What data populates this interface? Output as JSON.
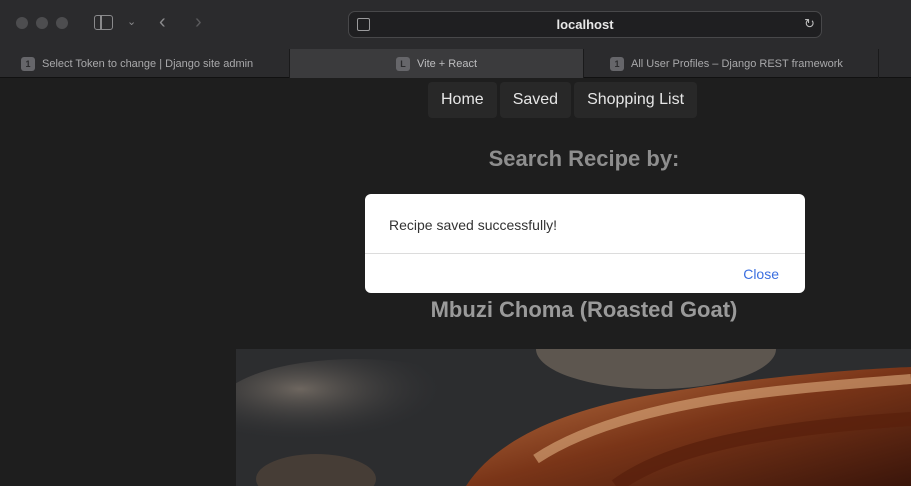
{
  "browser": {
    "address": "localhost",
    "tabs": [
      {
        "favicon": "1",
        "label": "Select Token to change | Django site admin"
      },
      {
        "favicon": "L",
        "label": "Vite + React"
      },
      {
        "favicon": "1",
        "label": "All User Profiles – Django REST framework"
      }
    ]
  },
  "nav": {
    "items": [
      "Home",
      "Saved",
      "Shopping List"
    ]
  },
  "main": {
    "search_heading": "Search Recipe by:",
    "recipe_title": "Mbuzi Choma (Roasted Goat)"
  },
  "modal": {
    "message": "Recipe saved successfully!",
    "close_label": "Close"
  },
  "colors": {
    "page_bg": "#1e1e1e",
    "modal_bg": "#ffffff",
    "link_accent": "#3b6fe0"
  }
}
